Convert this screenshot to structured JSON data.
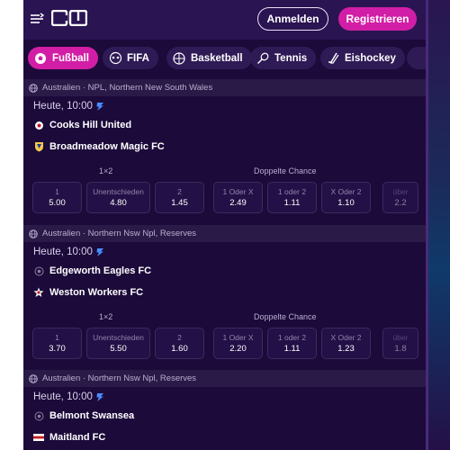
{
  "header": {
    "login_label": "Anmelden",
    "register_label": "Registrieren"
  },
  "sports": [
    {
      "label": "Fußball",
      "icon": "soccer-ball-icon",
      "active": true
    },
    {
      "label": "FIFA",
      "icon": "gamepad-icon",
      "active": false
    },
    {
      "label": "Basketball",
      "icon": "basketball-icon",
      "active": false
    },
    {
      "label": "Tennis",
      "icon": "tennis-racket-icon",
      "active": false
    },
    {
      "label": "Eishockey",
      "icon": "hockey-stick-icon",
      "active": false
    }
  ],
  "markets": {
    "m1x2": "1×2",
    "double": "Doppelte Chance"
  },
  "matches": [
    {
      "league": "Australien · NPL, Northern New South Wales",
      "time": "Heute, 10:00",
      "home": "Cooks Hill United",
      "away": "Broadmeadow Magic FC",
      "odds": [
        {
          "label": "1",
          "value": "5.00"
        },
        {
          "label": "Unentschieden",
          "value": "4.80"
        },
        {
          "label": "2",
          "value": "1.45"
        },
        {
          "label": "1 Oder X",
          "value": "2.49"
        },
        {
          "label": "1 oder 2",
          "value": "1.11"
        },
        {
          "label": "X Oder 2",
          "value": "1.10"
        },
        {
          "label": "über",
          "value": "2.2"
        }
      ]
    },
    {
      "league": "Australien · Northern Nsw Npl, Reserves",
      "time": "Heute, 10:00",
      "home": "Edgeworth Eagles FC",
      "away": "Weston Workers FC",
      "odds": [
        {
          "label": "1",
          "value": "3.70"
        },
        {
          "label": "Unentschieden",
          "value": "5.50"
        },
        {
          "label": "2",
          "value": "1.60"
        },
        {
          "label": "1 Oder X",
          "value": "2.20"
        },
        {
          "label": "1 oder 2",
          "value": "1.11"
        },
        {
          "label": "X Oder 2",
          "value": "1.23"
        },
        {
          "label": "über",
          "value": "1.8"
        }
      ]
    },
    {
      "league": "Australien · Northern Nsw Npl, Reserves",
      "time": "Heute, 10:00",
      "home": "Belmont Swansea",
      "away": "Maitland FC"
    }
  ],
  "colors": {
    "background": "#1c0a3a",
    "accent": "#d21ea6",
    "boost": "#4a8cff"
  }
}
